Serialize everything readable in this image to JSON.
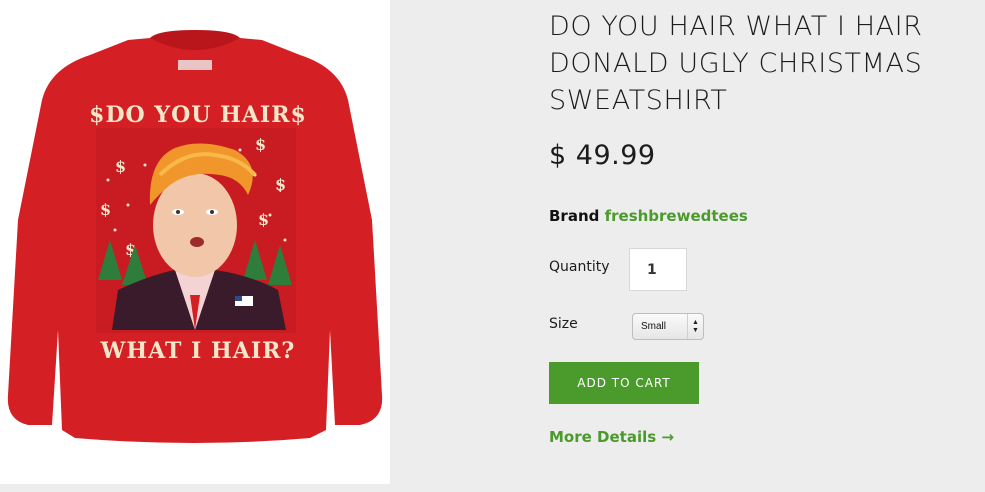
{
  "product": {
    "title_lines": [
      "DO YOU HAIR WHAT I HAIR",
      "DONALD UGLY CHRISTMAS",
      "SWEATSHIRT"
    ],
    "price": "$ 49.99",
    "brand_label": "Brand",
    "brand_name": "freshbrewedtees"
  },
  "image": {
    "text_top": "$DO YOU HAIR$",
    "text_bottom": "WHAT I HAIR?",
    "colors": {
      "sweater": "#d41f24",
      "text": "#f4e6c8",
      "hair": "#f0962a",
      "tree": "#2e7d3a"
    }
  },
  "form": {
    "quantity_label": "Quantity",
    "quantity_value": "1",
    "size_label": "Size",
    "size_value": "Small",
    "add_to_cart": "ADD TO CART",
    "more_details": "More Details →"
  },
  "colors": {
    "accent": "#4a9a2c",
    "background": "#ededed"
  }
}
